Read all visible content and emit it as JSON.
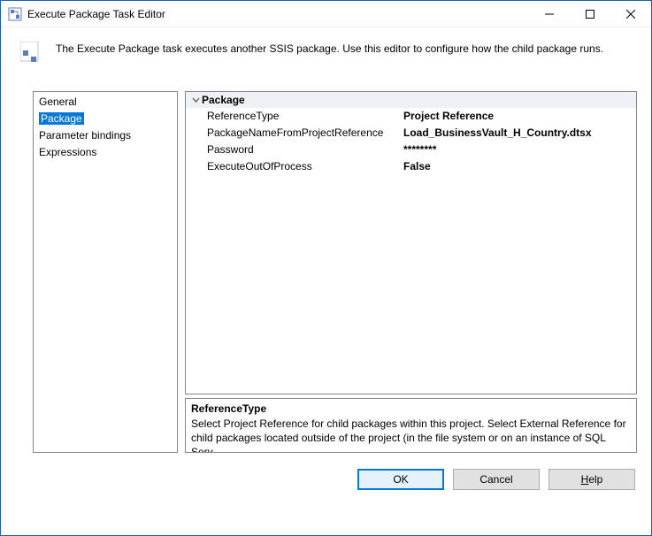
{
  "window": {
    "title": "Execute Package Task Editor"
  },
  "header": {
    "description": "The Execute Package task executes another SSIS package. Use this editor to configure how the child package runs."
  },
  "sidebar": {
    "items": [
      {
        "label": "General",
        "selected": false
      },
      {
        "label": "Package",
        "selected": true
      },
      {
        "label": "Parameter bindings",
        "selected": false
      },
      {
        "label": "Expressions",
        "selected": false
      }
    ]
  },
  "propertyGrid": {
    "category": "Package",
    "rows": [
      {
        "label": "ReferenceType",
        "value": "Project Reference"
      },
      {
        "label": "PackageNameFromProjectReference",
        "value": "Load_BusinessVault_H_Country.dtsx"
      },
      {
        "label": "Password",
        "value": "********"
      },
      {
        "label": "ExecuteOutOfProcess",
        "value": "False"
      }
    ]
  },
  "description": {
    "title": "ReferenceType",
    "text": "Select Project Reference for child packages within this project. Select External Reference for child packages located outside of the project (in the file system or on an instance of SQL Serv…"
  },
  "buttons": {
    "ok": "OK",
    "cancel": "Cancel",
    "help_prefix": "H",
    "help_suffix": "elp"
  }
}
